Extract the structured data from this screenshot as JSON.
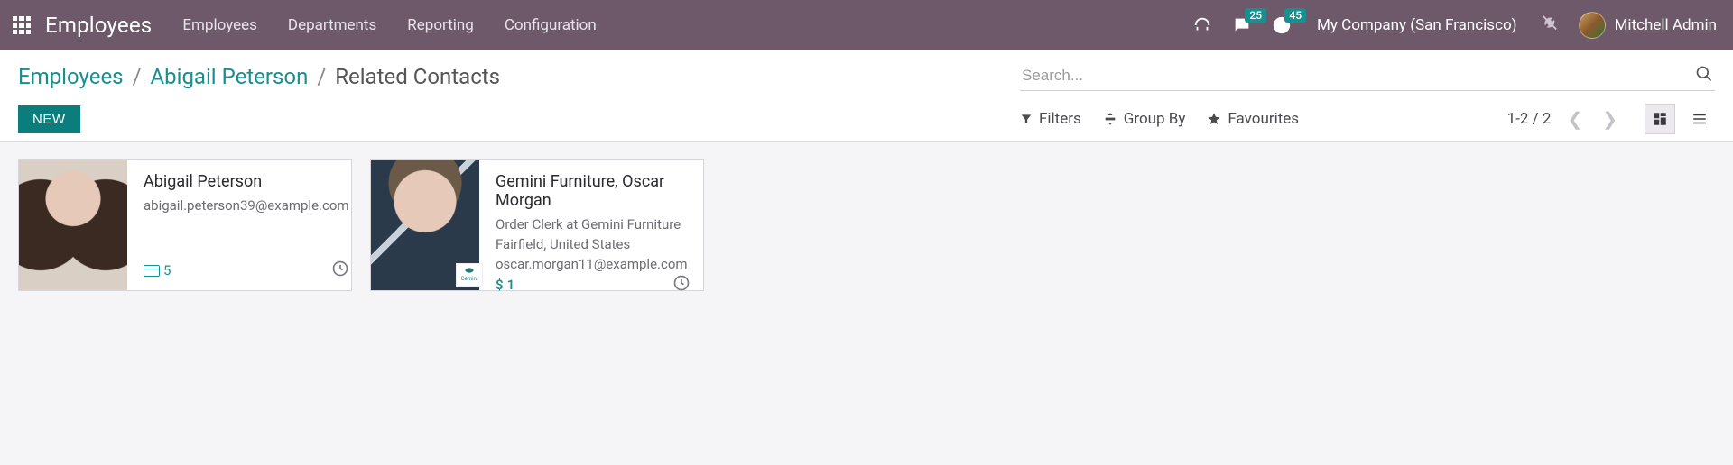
{
  "topnav": {
    "brand": "Employees",
    "items": [
      "Employees",
      "Departments",
      "Reporting",
      "Configuration"
    ],
    "messages_badge": "25",
    "activities_badge": "45",
    "company": "My Company (San Francisco)",
    "user_name": "Mitchell Admin"
  },
  "breadcrumb": {
    "root": "Employees",
    "parent": "Abigail Peterson",
    "current": "Related Contacts"
  },
  "controls": {
    "new_label": "NEW",
    "search_placeholder": "Search...",
    "filters_label": "Filters",
    "groupby_label": "Group By",
    "favourites_label": "Favourites",
    "pager_text": "1-2 / 2"
  },
  "cards": [
    {
      "title": "Abigail Peterson",
      "job": "",
      "location": "",
      "email": "abigail.peterson39@example.com",
      "badge_kind": "card",
      "badge_value": "5"
    },
    {
      "title": "Gemini Furniture, Oscar Morgan",
      "job": "Order Clerk at Gemini Furniture",
      "location": "Fairfield, United States",
      "email": "oscar.morgan11@example.com",
      "badge_kind": "dollar",
      "badge_value": "1"
    }
  ]
}
